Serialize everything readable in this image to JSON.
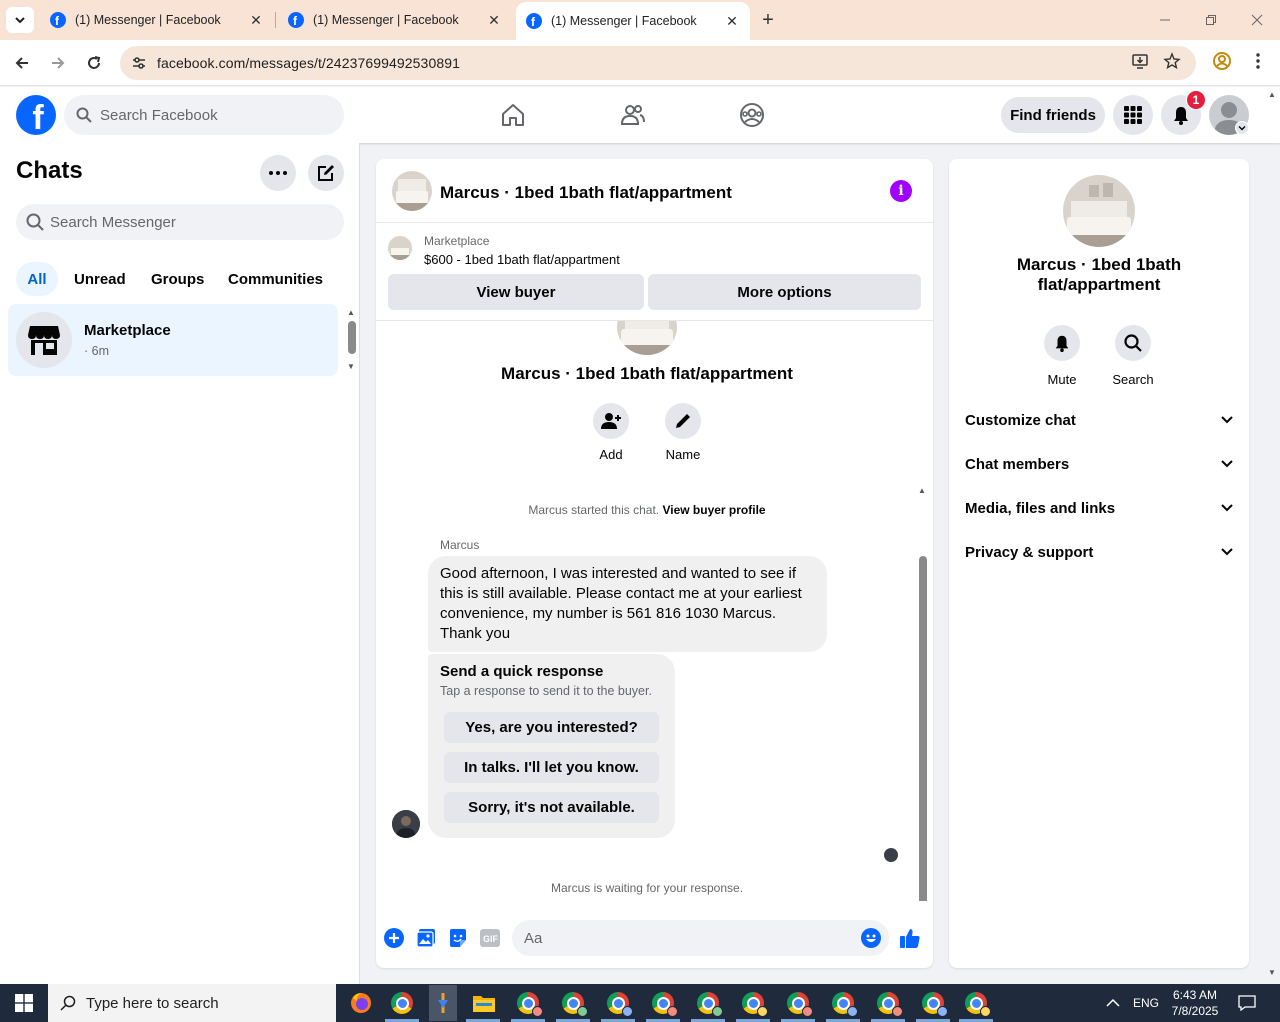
{
  "browser": {
    "tabs": [
      {
        "title": "(1) Messenger | Facebook",
        "active": false
      },
      {
        "title": "(1) Messenger | Facebook",
        "active": false
      },
      {
        "title": "(1) Messenger | Facebook",
        "active": true
      }
    ],
    "url": "facebook.com/messages/t/24237699492530891"
  },
  "fb_header": {
    "logo": "f",
    "search_placeholder": "Search Facebook",
    "find_friends": "Find friends",
    "notification_count": "1"
  },
  "left_panel": {
    "title": "Chats",
    "search_placeholder": "Search Messenger",
    "filters": [
      "All",
      "Unread",
      "Groups",
      "Communities"
    ],
    "active_filter": "All",
    "chats": [
      {
        "name": "Marketplace",
        "sub": "· 6m"
      }
    ]
  },
  "conversation": {
    "title": "Marcus · 1bed 1bath flat/appartment",
    "marketplace_label": "Marketplace",
    "listing": "$600 - 1bed 1bath flat/appartment",
    "view_buyer": "View buyer",
    "more_options": "More options",
    "name_center": "Marcus · 1bed 1bath flat/appartment",
    "actions": {
      "add": "Add",
      "name": "Name"
    },
    "started_text": "Marcus started this chat.",
    "started_link": "View buyer profile",
    "sender": "Marcus",
    "message": "Good afternoon, I was interested and wanted to see if this is still available.  Please contact me at your earliest convenience, my number is 561 816 1030 Marcus. Thank you",
    "quick_response": {
      "title": "Send a quick response",
      "subtitle": "Tap a response to send it to the buyer.",
      "options": [
        "Yes, are you interested?",
        "In talks. I'll let you know.",
        "Sorry, it's not available."
      ]
    },
    "waiting_text": "Marcus is waiting for your response.",
    "composer_placeholder": "Aa"
  },
  "right_panel": {
    "name": "Marcus · 1bed 1bath flat/appartment",
    "mute": "Mute",
    "search": "Search",
    "sections": [
      "Customize chat",
      "Chat members",
      "Media, files and links",
      "Privacy & support"
    ]
  },
  "taskbar": {
    "search_placeholder": "Type here to search",
    "language": "ENG",
    "time": "6:43 AM",
    "date": "7/8/2025"
  },
  "colors": {
    "brand": "#0866ff",
    "info": "#a100ff",
    "active_filter_bg": "#ebf5ff",
    "notification": "#e41e3f"
  }
}
